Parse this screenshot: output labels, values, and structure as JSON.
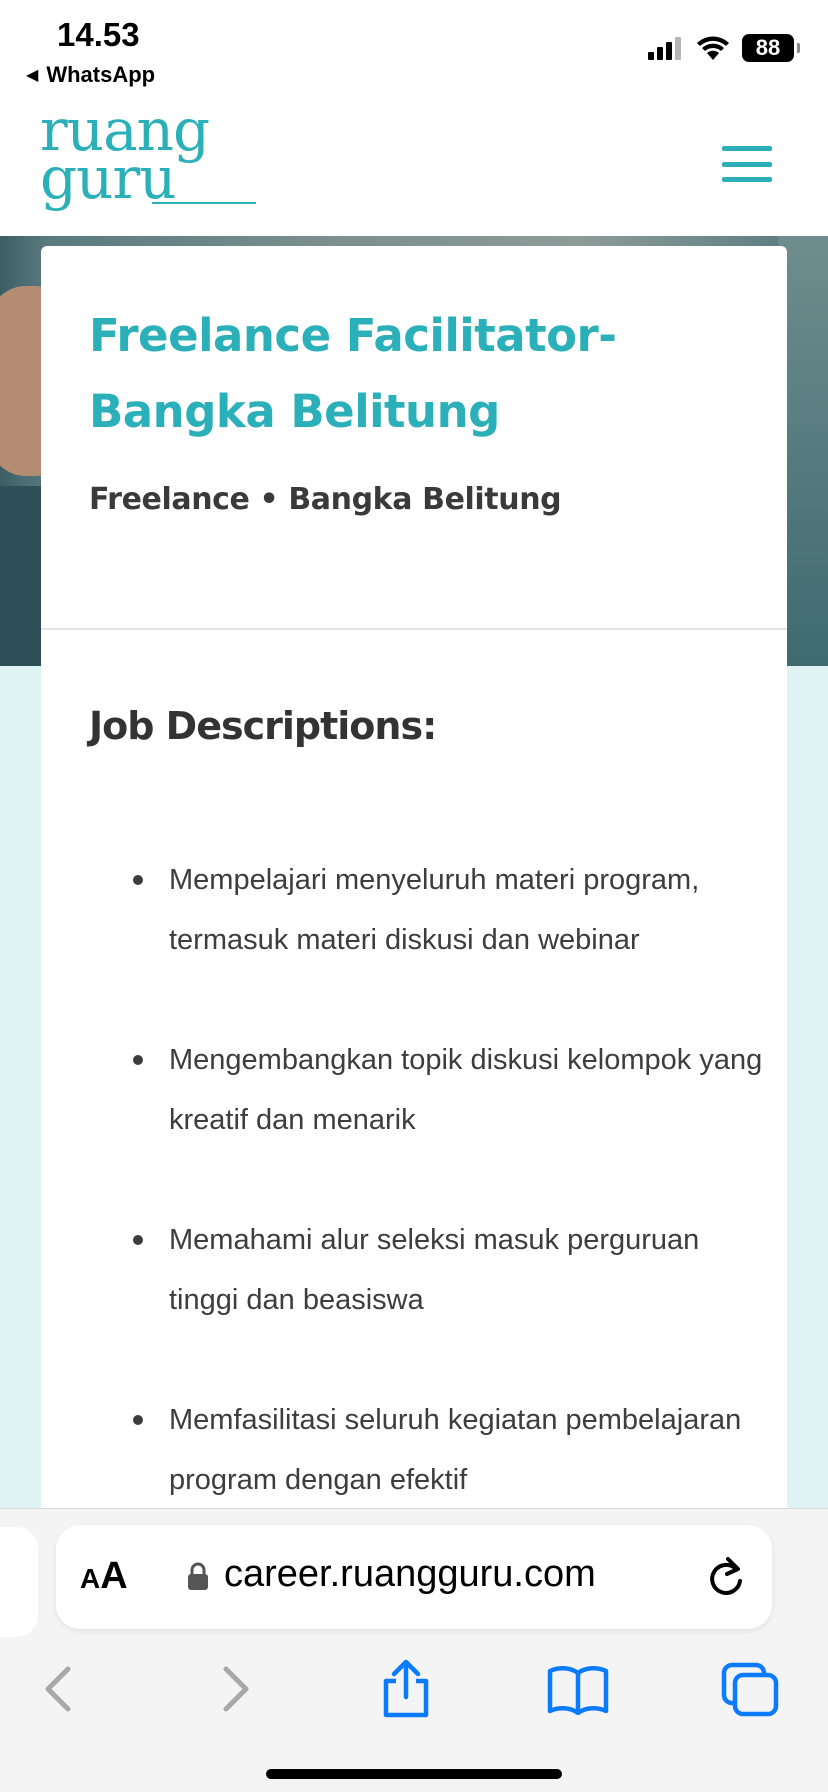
{
  "status_bar": {
    "time": "14.53",
    "back_app": "WhatsApp",
    "battery": "88"
  },
  "header": {
    "logo_line1": "ruang",
    "logo_line2": "guru"
  },
  "job": {
    "title": "Freelance Facilitator-Bangka Belitung",
    "meta": "Freelance • Bangka Belitung",
    "section_title": "Job Descriptions:",
    "descriptions": [
      "Mempelajari menyeluruh materi program, termasuk materi diskusi dan webinar",
      "Mengembangkan topik diskusi kelompok yang kreatif dan menarik",
      "Memahami alur seleksi masuk perguruan tinggi dan beasiswa",
      "Memfasilitasi seluruh kegiatan pembelajaran program dengan efektif"
    ]
  },
  "browser": {
    "aa_label_small": "A",
    "aa_label_large": "A",
    "url": "career.ruangguru.com"
  },
  "colors": {
    "brand": "#2bb0b9",
    "ios_blue": "#0a7aff",
    "teal_bg": "#dff3f4"
  }
}
